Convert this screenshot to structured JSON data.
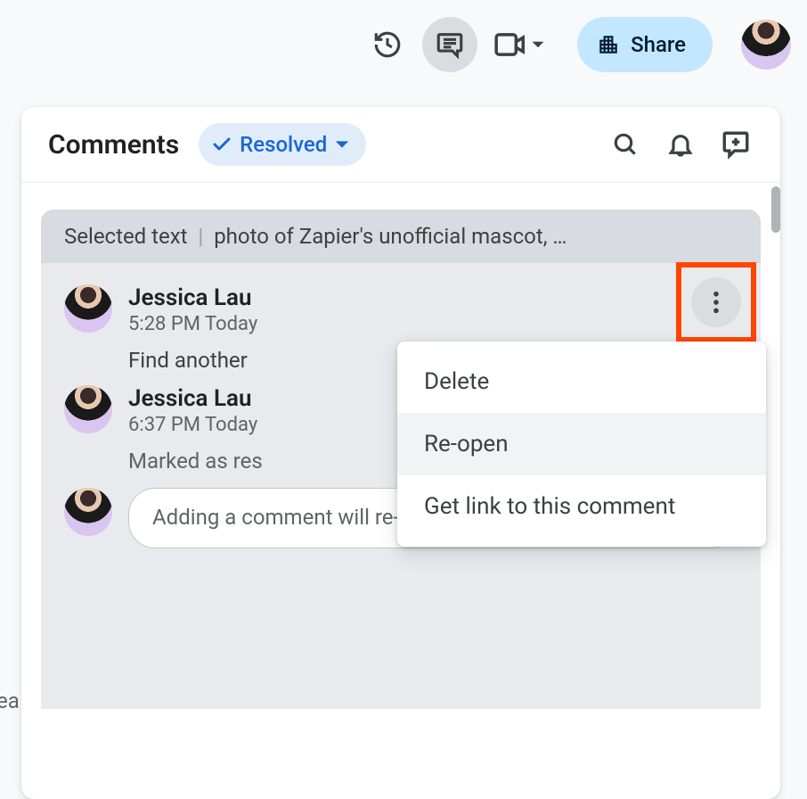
{
  "toolbar": {
    "share_label": "Share"
  },
  "panel": {
    "title": "Comments",
    "filter_label": "Resolved"
  },
  "card": {
    "context_prefix": "Selected text",
    "context_snippet": "photo of Zapier's unofficial mascot, …",
    "comments": [
      {
        "author": "Jessica Lau",
        "timestamp": "5:28 PM Today",
        "body": "Find another"
      },
      {
        "author": "Jessica Lau",
        "timestamp": "6:37 PM Today",
        "status": "Marked as res"
      }
    ],
    "reply_placeholder": "Adding a comment will re-open this discussion…"
  },
  "menu": {
    "items": [
      "Delete",
      "Re-open",
      "Get link to this comment"
    ]
  },
  "bg_fragment": "ea"
}
